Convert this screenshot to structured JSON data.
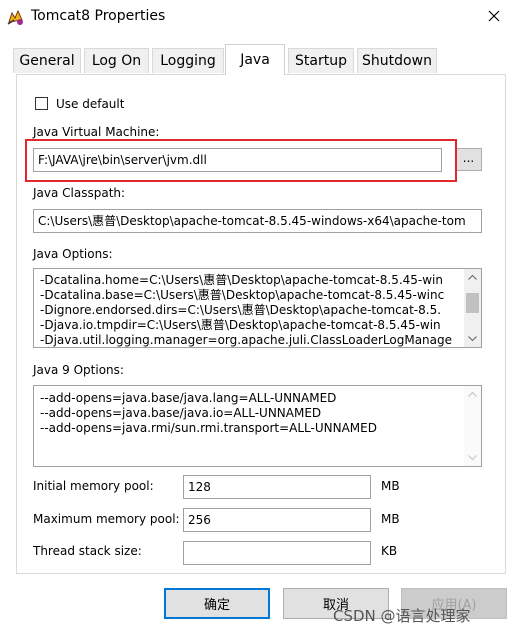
{
  "window": {
    "title": "Tomcat8 Properties"
  },
  "tabs": [
    {
      "label": "General",
      "active": false
    },
    {
      "label": "Log On",
      "active": false
    },
    {
      "label": "Logging",
      "active": false
    },
    {
      "label": "Java",
      "active": true
    },
    {
      "label": "Startup",
      "active": false
    },
    {
      "label": "Shutdown",
      "active": false
    }
  ],
  "java": {
    "use_default_label": "Use default",
    "use_default_checked": false,
    "jvm_label": "Java Virtual Machine:",
    "jvm_value": "F:\\JAVA\\jre\\bin\\server\\jvm.dll",
    "browse_label": "...",
    "classpath_label": "Java Classpath:",
    "classpath_value": "C:\\Users\\惠普\\Desktop\\apache-tomcat-8.5.45-windows-x64\\apache-tom",
    "options_label": "Java Options:",
    "options_lines": [
      "-Dcatalina.home=C:\\Users\\惠普\\Desktop\\apache-tomcat-8.5.45-win",
      "-Dcatalina.base=C:\\Users\\惠普\\Desktop\\apache-tomcat-8.5.45-winc",
      "-Dignore.endorsed.dirs=C:\\Users\\惠普\\Desktop\\apache-tomcat-8.5.",
      "-Djava.io.tmpdir=C:\\Users\\惠普\\Desktop\\apache-tomcat-8.5.45-win",
      "-Djava.util.logging.manager=org.apache.juli.ClassLoaderLogManage"
    ],
    "java9_label": "Java 9 Options:",
    "java9_lines": [
      "--add-opens=java.base/java.lang=ALL-UNNAMED",
      "--add-opens=java.base/java.io=ALL-UNNAMED",
      "--add-opens=java.rmi/sun.rmi.transport=ALL-UNNAMED"
    ],
    "initial_pool_label": "Initial memory pool:",
    "initial_pool_value": "128",
    "max_pool_label": "Maximum memory pool:",
    "max_pool_value": "256",
    "stack_label": "Thread stack size:",
    "stack_value": "",
    "unit_mb": "MB",
    "unit_kb": "KB"
  },
  "buttons": {
    "ok": "确定",
    "cancel": "取消",
    "apply": "应用(A)"
  },
  "watermark": "CSDN @语言处理家",
  "colors": {
    "highlight": "#e0282e",
    "accent": "#0078d7"
  }
}
